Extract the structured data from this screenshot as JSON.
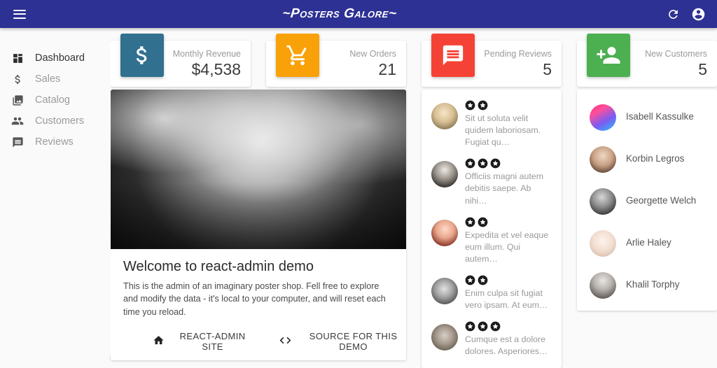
{
  "appbar": {
    "title": "~Posters Galore~",
    "menu_icon": "hamburger-menu-icon",
    "refresh_icon": "refresh-icon",
    "account_icon": "account-circle-icon"
  },
  "sidebar": {
    "items": [
      {
        "label": "Dashboard",
        "icon": "dashboard-icon",
        "active": true
      },
      {
        "label": "Sales",
        "icon": "dollar-icon",
        "active": false
      },
      {
        "label": "Catalog",
        "icon": "collections-image-icon",
        "active": false
      },
      {
        "label": "Customers",
        "icon": "people-icon",
        "active": false
      },
      {
        "label": "Reviews",
        "icon": "comment-icon",
        "active": false
      }
    ]
  },
  "stats": [
    {
      "label": "Monthly Revenue",
      "value": "$4,538",
      "icon": "dollar-icon",
      "color": "#31708f"
    },
    {
      "label": "New Orders",
      "value": "21",
      "icon": "shopping-cart-icon",
      "color": "#f9a109"
    },
    {
      "label": "Pending Reviews",
      "value": "5",
      "icon": "comment-icon",
      "color": "#f44336"
    },
    {
      "label": "New Customers",
      "value": "5",
      "icon": "person-add-icon",
      "color": "#4caf50"
    }
  ],
  "welcome": {
    "title": "Welcome to react-admin demo",
    "text": "This is the admin of an imaginary poster shop. Fell free to explore and modify the data - it's local to your computer, and will reset each time you reload.",
    "buttons": [
      {
        "label": "REACT-ADMIN SITE",
        "icon": "home-icon"
      },
      {
        "label": "SOURCE FOR THIS DEMO",
        "icon": "code-icon"
      }
    ]
  },
  "reviews": [
    {
      "stars": 2,
      "text": "Sit ut soluta velit quidem laboriosam. Fugiat qu…",
      "avatar": "av6"
    },
    {
      "stars": 3,
      "text": "Officiis magni autem debitis saepe. Ab nihi…",
      "avatar": "av7"
    },
    {
      "stars": 2,
      "text": "Expedita et vel eaque eum illum. Qui autem…",
      "avatar": "av8"
    },
    {
      "stars": 2,
      "text": "Enim culpa sit fugiat vero ipsam. At eum…",
      "avatar": "av9"
    },
    {
      "stars": 3,
      "text": "Cumque est a dolore dolores. Asperiores…",
      "avatar": "av10"
    }
  ],
  "customers": [
    {
      "name": "Isabell Kassulke",
      "avatar": "av1"
    },
    {
      "name": "Korbin Legros",
      "avatar": "av2"
    },
    {
      "name": "Georgette Welch",
      "avatar": "av3"
    },
    {
      "name": "Arlie Haley",
      "avatar": "av4"
    },
    {
      "name": "Khalil Torphy",
      "avatar": "av5"
    }
  ]
}
